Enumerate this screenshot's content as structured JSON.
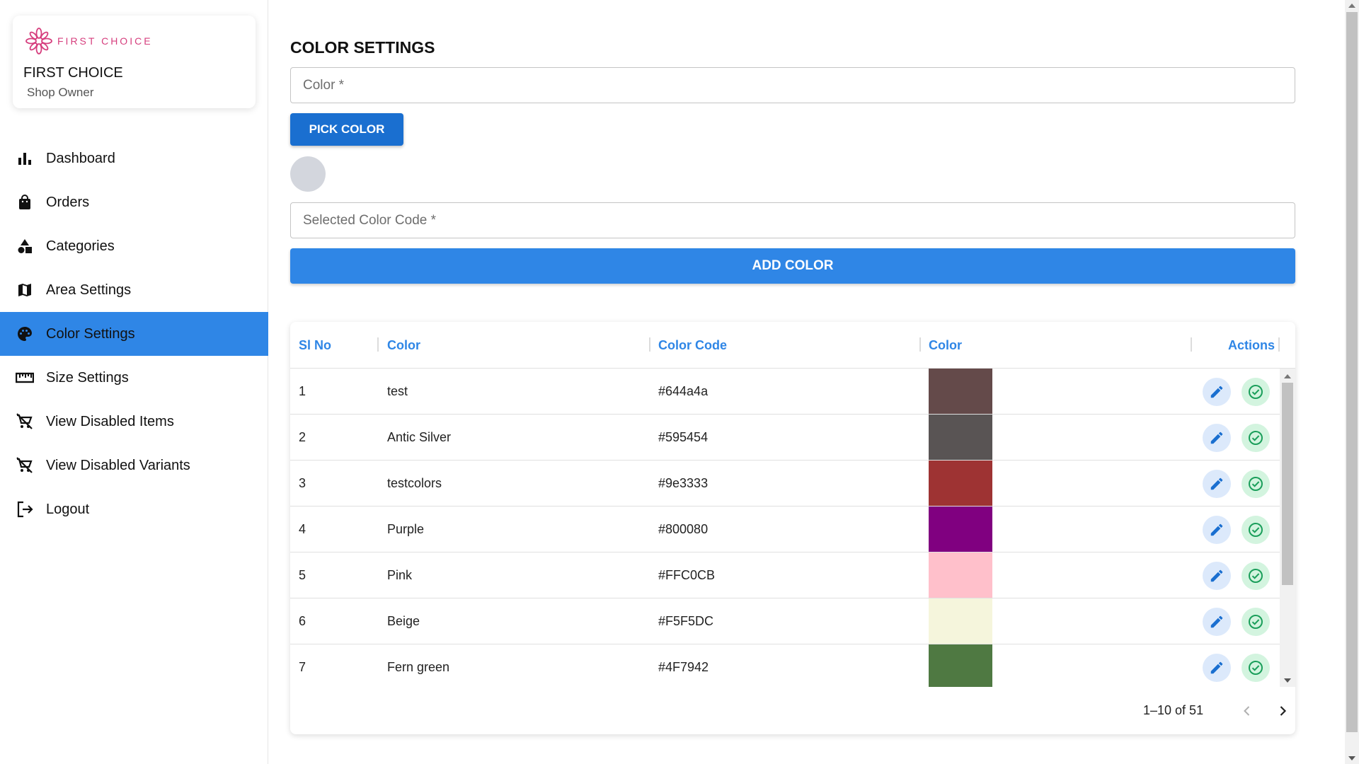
{
  "brand": {
    "logo_text": "FIRST CHOICE",
    "name": "FIRST CHOICE",
    "role": "Shop Owner"
  },
  "nav": {
    "items": [
      {
        "label": "Dashboard",
        "icon": "bar-chart-icon"
      },
      {
        "label": "Orders",
        "icon": "shopping-bag-icon"
      },
      {
        "label": "Categories",
        "icon": "shapes-icon"
      },
      {
        "label": "Area Settings",
        "icon": "map-icon"
      },
      {
        "label": "Color Settings",
        "icon": "palette-icon",
        "active": true
      },
      {
        "label": "Size Settings",
        "icon": "ruler-icon"
      },
      {
        "label": "View Disabled Items",
        "icon": "remove-shopping-cart-icon"
      },
      {
        "label": "View Disabled Variants",
        "icon": "remove-shopping-cart-icon"
      },
      {
        "label": "Logout",
        "icon": "logout-icon"
      }
    ]
  },
  "main": {
    "title": "COLOR SETTINGS",
    "color_placeholder": "Color *",
    "pick_label": "PICK COLOR",
    "code_placeholder": "Selected Color Code *",
    "add_label": "ADD COLOR",
    "preview_color": "#d3d6dd"
  },
  "table": {
    "headers": {
      "sl": "Sl No",
      "color": "Color",
      "code": "Color Code",
      "swatch": "Color",
      "actions": "Actions"
    },
    "rows": [
      {
        "sl": "1",
        "name": "test",
        "code": "#644a4a",
        "swatch": "#644a4a"
      },
      {
        "sl": "2",
        "name": "Antic Silver",
        "code": "#595454",
        "swatch": "#595454"
      },
      {
        "sl": "3",
        "name": "testcolors",
        "code": "#9e3333",
        "swatch": "#9e3333"
      },
      {
        "sl": "4",
        "name": "Purple",
        "code": "#800080",
        "swatch": "#800080"
      },
      {
        "sl": "5",
        "name": "Pink",
        "code": "#FFC0CB",
        "swatch": "#FFC0CB"
      },
      {
        "sl": "6",
        "name": "Beige",
        "code": "#F5F5DC",
        "swatch": "#F5F5DC"
      },
      {
        "sl": "7",
        "name": "Fern green",
        "code": "#4F7942",
        "swatch": "#4F7942"
      }
    ],
    "pagination": "1–10 of 51"
  },
  "colors": {
    "accent": "#2f86e6",
    "button_dark": "#1a6fd0",
    "edit_icon": "#1a6fd0",
    "check_icon": "#1a9e5a"
  }
}
